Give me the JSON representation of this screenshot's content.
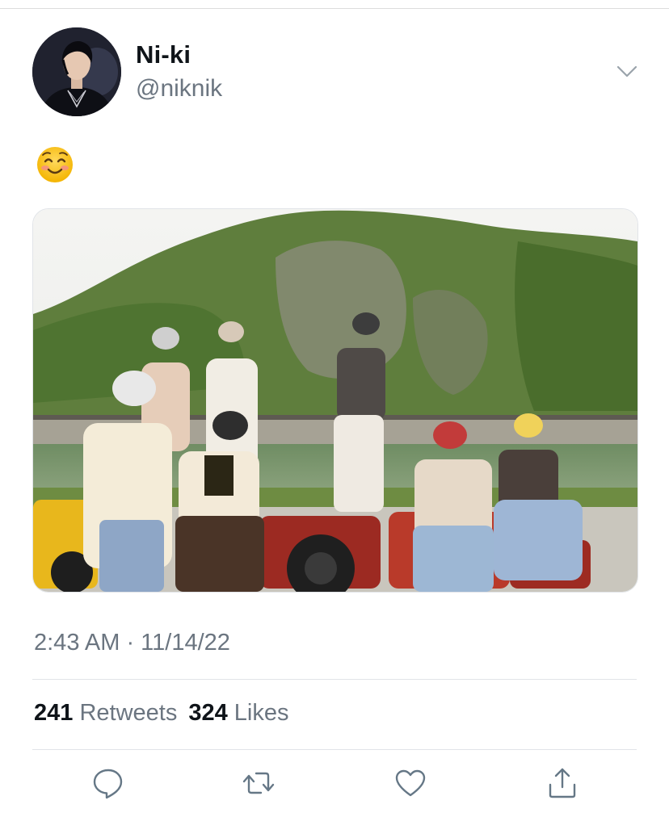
{
  "user": {
    "display_name": "Ni-ki",
    "handle": "@niknik"
  },
  "tweet": {
    "emoji_icon": "smiling-face-icon",
    "timestamp": "2:43 AM · 11/14/22",
    "media_alt": "photo"
  },
  "stats": {
    "retweets_count": "241",
    "retweets_label": "Retweets",
    "likes_count": "324",
    "likes_label": "Likes"
  },
  "actions": {
    "reply_icon": "reply-icon",
    "retweet_icon": "retweet-icon",
    "like_icon": "heart-icon",
    "share_icon": "share-icon"
  },
  "colors": {
    "text_primary": "#0f1419",
    "text_secondary": "#6b7580",
    "divider": "#e1e4e8",
    "icon": "#657786"
  }
}
